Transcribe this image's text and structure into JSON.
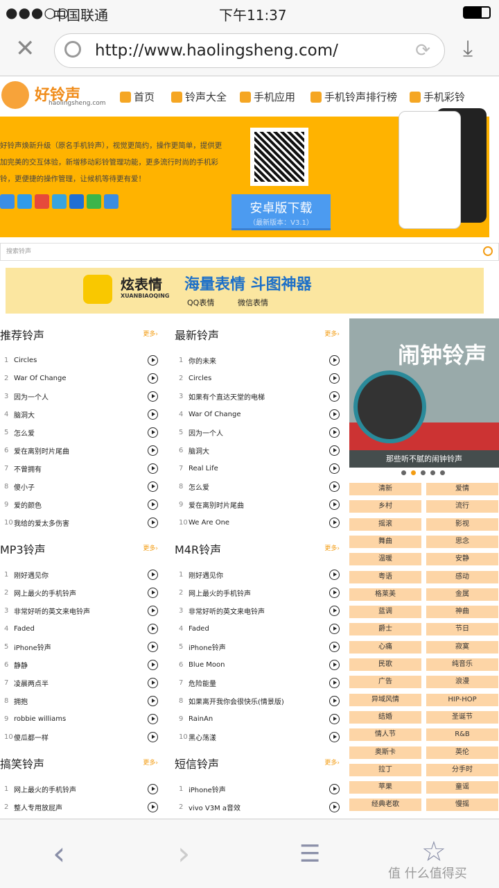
{
  "status": {
    "carrier": "中国联通",
    "time": "下午11:37"
  },
  "browser": {
    "url": "http://www.haolingsheng.com/"
  },
  "site": {
    "logo": "好铃声",
    "logo_domain": "haolingsheng.com",
    "nav": [
      "首页",
      "铃声大全",
      "手机应用",
      "手机铃声排行榜",
      "手机彩铃"
    ]
  },
  "banner": {
    "desc": "好铃声焕新升级（原名手机铃声），视觉更简约，操作更简单，提供更加完美的交互体验，新增移动彩铃管理功能，更多流行时尚的手机彩铃，更便捷的操作管理，让候机等待更有爱！",
    "download": "安卓版下载",
    "version": "（最新版本：V3.1）"
  },
  "search": {
    "placeholder": "搜索铃声"
  },
  "ad": {
    "brand": "炫表情",
    "brand_pinyin": "XUANBIAOQING",
    "slogan": "海量表情 斗图神器",
    "qq": "QQ表情",
    "wechat": "微信表情"
  },
  "more": "更多›",
  "sections": [
    {
      "title": "推荐铃声",
      "items": [
        "Circles",
        "War Of Change",
        "因为一个人",
        "脑洞大",
        "怎么爱",
        "爱在离别时片尾曲",
        "不曾拥有",
        "傻小子",
        "爱的颜色",
        "我给的爱太多伤害"
      ]
    },
    {
      "title": "最新铃声",
      "items": [
        "你的未来",
        "Circles",
        "如果有个直达天堂的电梯",
        "War Of Change",
        "因为一个人",
        "脑洞大",
        "Real Life",
        "怎么爱",
        "爱在离别时片尾曲",
        "We Are One"
      ]
    },
    {
      "title": "MP3铃声",
      "items": [
        "刚好遇见你",
        "网上最火的手机铃声",
        "非常好听的英文来电铃声",
        "Faded",
        "iPhone铃声",
        "静静",
        "凌晨两点半",
        "拥抱",
        "robbie williams",
        "傻瓜都一样"
      ]
    },
    {
      "title": "M4R铃声",
      "items": [
        "刚好遇见你",
        "网上最火的手机铃声",
        "非常好听的英文来电铃声",
        "Faded",
        "iPhone铃声",
        "Blue Moon",
        "危险能量",
        "如果离开我你会很快乐(情景版)",
        "RainAn",
        "黑心荡漾"
      ]
    },
    {
      "title": "搞笑铃声",
      "items": [
        "网上最火的手机铃声",
        "整人专用放屁声"
      ]
    },
    {
      "title": "短信铃声",
      "items": [
        "iPhone铃声",
        "vivo V3M a音效"
      ]
    }
  ],
  "slider": {
    "title": "闹钟铃声",
    "caption": "那些听不腻的闹钟铃声",
    "active_dot": 2,
    "dots": 5
  },
  "tags": [
    "清新",
    "爱情",
    "乡村",
    "流行",
    "摇滚",
    "影视",
    "舞曲",
    "思念",
    "温暖",
    "安静",
    "粤语",
    "感动",
    "格莱美",
    "金属",
    "蓝调",
    "神曲",
    "爵士",
    "节日",
    "心痛",
    "寂寞",
    "民歌",
    "纯音乐",
    "广告",
    "浪漫",
    "异域风情",
    "HIP-HOP",
    "结婚",
    "圣诞节",
    "情人节",
    "R&B",
    "奥斯卡",
    "英伦",
    "拉丁",
    "分手时",
    "苹果",
    "童谣",
    "经典老歌",
    "慢摇"
  ],
  "watermark": "值 什么值得买",
  "colors": {
    "accent": "#ffb300",
    "download": "#4c9bf0",
    "tag": "#fdd5a6",
    "more": "#f39c12"
  }
}
